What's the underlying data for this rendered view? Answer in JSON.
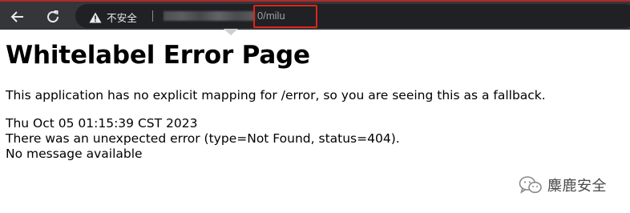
{
  "browser": {
    "security_label": "不安全",
    "url_path": "0/milu",
    "icons": {
      "back": "back-arrow-icon",
      "reload": "reload-icon",
      "warning": "warning-icon"
    },
    "highlight_color": "#e0241c"
  },
  "page": {
    "title": "Whitelabel Error Page",
    "fallback_message": "This application has no explicit mapping for /error, so you are seeing this as a fallback.",
    "timestamp": "Thu Oct 05 01:15:39 CST 2023",
    "error_line": "There was an unexpected error (type=Not Found, status=404).",
    "detail": "No message available"
  },
  "watermark": {
    "text": "麋鹿安全",
    "icon": "wechat-icon"
  }
}
